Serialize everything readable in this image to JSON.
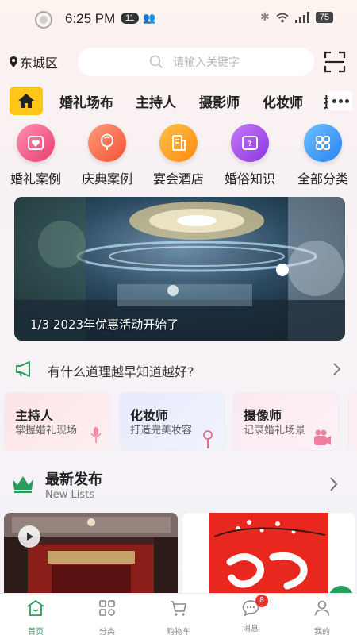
{
  "status_bar": {
    "time": "6:25 PM",
    "badge": "11",
    "battery": "75"
  },
  "header": {
    "location": "东城区",
    "search_placeholder": "请输入关键字"
  },
  "tabs": [
    {
      "label": "婚礼场布"
    },
    {
      "label": "主持人"
    },
    {
      "label": "摄影师"
    },
    {
      "label": "化妆师"
    }
  ],
  "icon_grid": [
    {
      "label": "婚礼案例",
      "icon": "heart-frame-icon",
      "color": "#f04f7d"
    },
    {
      "label": "庆典案例",
      "icon": "balloon-icon",
      "color": "#ff6a4a"
    },
    {
      "label": "宴会酒店",
      "icon": "building-icon",
      "color": "#ff9e1b"
    },
    {
      "label": "婚俗知识",
      "icon": "book-icon",
      "color": "#a246e8"
    },
    {
      "label": "全部分类",
      "icon": "grid-icon",
      "color": "#2f8ff3"
    }
  ],
  "banner": {
    "caption": "1/3 2023年优惠活动开始了"
  },
  "notice": {
    "text": "有什么道理越早知道越好?"
  },
  "cards": [
    {
      "title": "主持人",
      "subtitle": "掌握婚礼现场",
      "icon": "microphone-icon"
    },
    {
      "title": "化妆师",
      "subtitle": "打造完美妆容",
      "icon": "makeup-brush-icon"
    },
    {
      "title": "摄像师",
      "subtitle": "记录婚礼场景",
      "icon": "camera-icon"
    }
  ],
  "latest": {
    "title": "最新发布",
    "subtitle": "New Lists"
  },
  "bottom_nav": [
    {
      "label": "首页",
      "icon": "home-icon",
      "active": true
    },
    {
      "label": "分类",
      "icon": "category-icon"
    },
    {
      "label": "购物车",
      "icon": "cart-icon"
    },
    {
      "label": "消息",
      "icon": "message-icon",
      "badge": "8"
    },
    {
      "label": "我的",
      "icon": "profile-icon"
    }
  ],
  "colors": {
    "accent_green": "#2a9d5c",
    "home_tab": "#ffc61a",
    "badge_red": "#e8352b"
  }
}
